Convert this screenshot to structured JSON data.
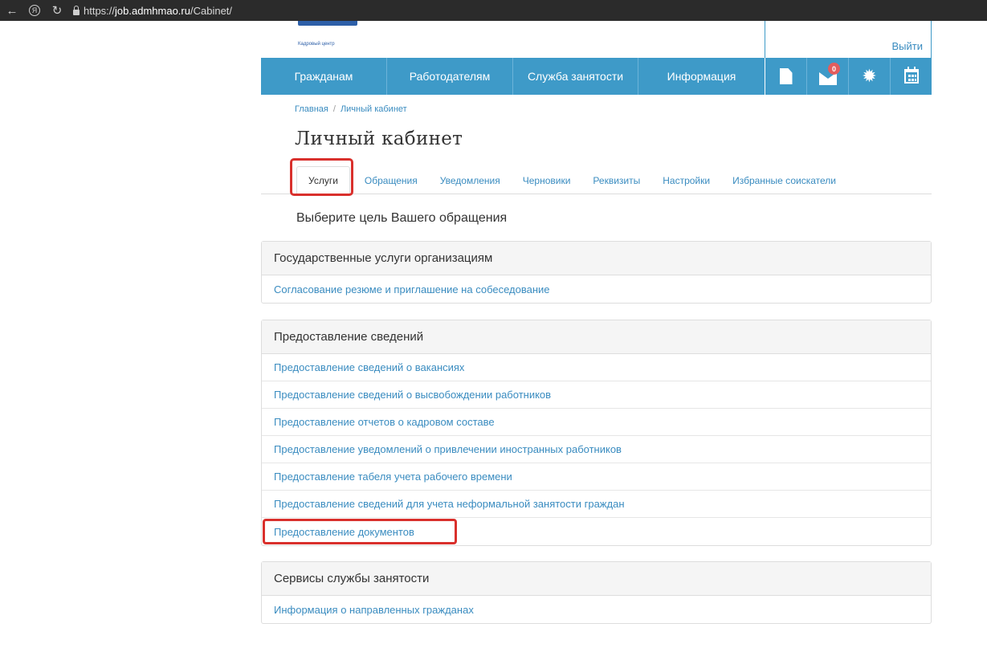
{
  "browser": {
    "url_prefix": "https://",
    "url_domain": "job.admhmao.ru",
    "url_path": "/Cabinet/"
  },
  "header": {
    "logo_subtitle": "Кадровый центр",
    "logout": "Выйти"
  },
  "nav": {
    "items": [
      "Гражданам",
      "Работодателям",
      "Служба занятости",
      "Информация"
    ],
    "messages_badge": "0"
  },
  "breadcrumb": {
    "home": "Главная",
    "separator": "/",
    "current": "Личный кабинет"
  },
  "page": {
    "title": "Личный кабинет",
    "intro": "Выберите цель Вашего обращения"
  },
  "tabs": [
    "Услуги",
    "Обращения",
    "Уведомления",
    "Черновики",
    "Реквизиты",
    "Настройки",
    "Избранные соискатели"
  ],
  "panels": [
    {
      "heading": "Государственные услуги организациям",
      "items": [
        "Согласование резюме и приглашение на собеседование"
      ]
    },
    {
      "heading": "Предоставление сведений",
      "items": [
        "Предоставление сведений о вакансиях",
        "Предоставление сведений о высвобождении работников",
        "Предоставление отчетов о кадровом составе",
        "Предоставление уведомлений о привлечении иностранных работников",
        "Предоставление табеля учета рабочего времени",
        "Предоставление сведений для учета неформальной занятости граждан",
        "Предоставление документов"
      ]
    },
    {
      "heading": "Сервисы службы занятости",
      "items": [
        "Информация о направленных гражданах"
      ]
    }
  ],
  "colors": {
    "nav_bg": "#3e9ac8",
    "link": "#3a8cc0",
    "highlight": "#d9302c",
    "badge": "#e35d5d"
  }
}
